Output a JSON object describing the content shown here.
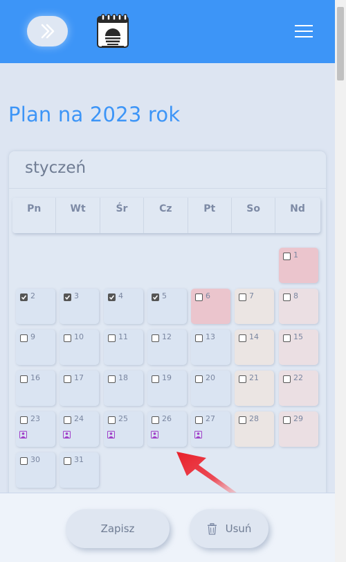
{
  "page_title": "Plan na 2023 rok",
  "month": {
    "name": "styczeń",
    "weekdays": [
      "Pn",
      "Wt",
      "Śr",
      "Cz",
      "Pt",
      "So",
      "Nd"
    ],
    "days": [
      {
        "n": "1",
        "checked": false,
        "type": "holiday",
        "person": false
      },
      {
        "n": "2",
        "checked": true,
        "type": "weekday",
        "person": false
      },
      {
        "n": "3",
        "checked": true,
        "type": "weekday",
        "person": false
      },
      {
        "n": "4",
        "checked": true,
        "type": "weekday",
        "person": false
      },
      {
        "n": "5",
        "checked": true,
        "type": "weekday",
        "person": false
      },
      {
        "n": "6",
        "checked": false,
        "type": "holiday",
        "person": false
      },
      {
        "n": "7",
        "checked": false,
        "type": "saturday",
        "person": false
      },
      {
        "n": "8",
        "checked": false,
        "type": "sunday",
        "person": false
      },
      {
        "n": "9",
        "checked": false,
        "type": "weekday",
        "person": false
      },
      {
        "n": "10",
        "checked": false,
        "type": "weekday",
        "person": false
      },
      {
        "n": "11",
        "checked": false,
        "type": "weekday",
        "person": false
      },
      {
        "n": "12",
        "checked": false,
        "type": "weekday",
        "person": false
      },
      {
        "n": "13",
        "checked": false,
        "type": "weekday",
        "person": false
      },
      {
        "n": "14",
        "checked": false,
        "type": "saturday",
        "person": false
      },
      {
        "n": "15",
        "checked": false,
        "type": "sunday",
        "person": false
      },
      {
        "n": "16",
        "checked": false,
        "type": "weekday",
        "person": false
      },
      {
        "n": "17",
        "checked": false,
        "type": "weekday",
        "person": false
      },
      {
        "n": "18",
        "checked": false,
        "type": "weekday",
        "person": false
      },
      {
        "n": "19",
        "checked": false,
        "type": "weekday",
        "person": false
      },
      {
        "n": "20",
        "checked": false,
        "type": "weekday",
        "person": false
      },
      {
        "n": "21",
        "checked": false,
        "type": "saturday",
        "person": false
      },
      {
        "n": "22",
        "checked": false,
        "type": "sunday",
        "person": false
      },
      {
        "n": "23",
        "checked": false,
        "type": "weekday",
        "person": true
      },
      {
        "n": "24",
        "checked": false,
        "type": "weekday",
        "person": true
      },
      {
        "n": "25",
        "checked": false,
        "type": "weekday",
        "person": true
      },
      {
        "n": "26",
        "checked": false,
        "type": "weekday",
        "person": true
      },
      {
        "n": "27",
        "checked": false,
        "type": "weekday",
        "person": true
      },
      {
        "n": "28",
        "checked": false,
        "type": "saturday",
        "person": false
      },
      {
        "n": "29",
        "checked": false,
        "type": "sunday",
        "person": false
      },
      {
        "n": "30",
        "checked": false,
        "type": "weekday",
        "person": false
      },
      {
        "n": "31",
        "checked": false,
        "type": "weekday",
        "person": false
      }
    ]
  },
  "footer": {
    "save_label": "Zapisz",
    "delete_label": "Usuń"
  },
  "colors": {
    "accent": "#3d95f7",
    "holiday": "#ebc5cd",
    "saturday": "#ebe5e3",
    "sunday": "#ebdfe3",
    "weekday": "#dae4f2",
    "person_icon": "#a040c8",
    "arrow": "#e8202a"
  },
  "icons": {
    "expand": "double-chevron-right-icon",
    "app": "calendar-sunset-icon",
    "menu": "hamburger-icon",
    "delete": "trash-icon",
    "person": "person-icon"
  }
}
